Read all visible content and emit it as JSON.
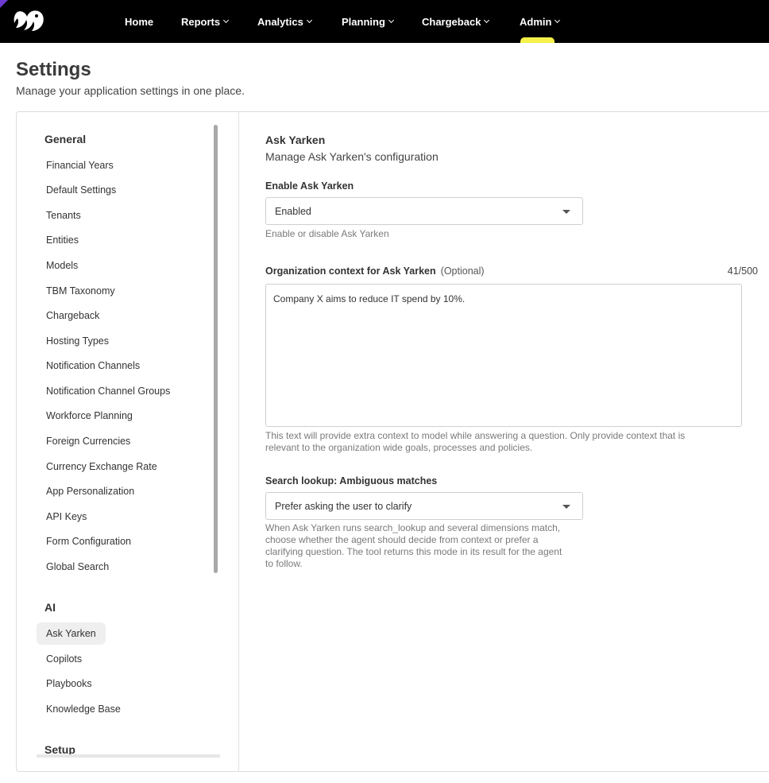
{
  "nav": {
    "items": [
      {
        "label": "Home",
        "has_dropdown": false
      },
      {
        "label": "Reports",
        "has_dropdown": true
      },
      {
        "label": "Analytics",
        "has_dropdown": true
      },
      {
        "label": "Planning",
        "has_dropdown": true
      },
      {
        "label": "Chargeback",
        "has_dropdown": true
      },
      {
        "label": "Admin",
        "has_dropdown": true,
        "active": true
      }
    ],
    "active_indicator_color": "#f6f14a",
    "background": "#000000"
  },
  "page": {
    "title": "Settings",
    "subtitle": "Manage your application settings in one place."
  },
  "sidebar": {
    "groups": [
      {
        "title": "General",
        "items": [
          "Financial Years",
          "Default Settings",
          "Tenants",
          "Entities",
          "Models",
          "TBM Taxonomy",
          "Chargeback",
          "Hosting Types",
          "Notification Channels",
          "Notification Channel Groups",
          "Workforce Planning",
          "Foreign Currencies",
          "Currency Exchange Rate",
          "App Personalization",
          "API Keys",
          "Form Configuration",
          "Global Search"
        ]
      },
      {
        "title": "AI",
        "items": [
          "Ask Yarken",
          "Copilots",
          "Playbooks",
          "Knowledge Base"
        ],
        "active_item": "Ask Yarken"
      },
      {
        "title": "Setup",
        "items": []
      }
    ]
  },
  "content": {
    "title": "Ask Yarken",
    "description": "Manage Ask Yarken's configuration",
    "enable": {
      "label": "Enable Ask Yarken",
      "value": "Enabled",
      "help": "Enable or disable Ask Yarken"
    },
    "context": {
      "label": "Organization context for Ask Yarken",
      "optional": "(Optional)",
      "counter": "41/500",
      "value": "Company X aims to reduce IT spend by 10%.",
      "help_line1": "This text will provide extra context to model while answering a question. Only provide context that is",
      "help_line2": "relevant to the organization wide goals, processes and policies."
    },
    "lookup": {
      "label": "Search lookup: Ambiguous matches",
      "value": "Prefer asking the user to clarify",
      "help_line1": "When Ask Yarken runs search_lookup and several dimensions match,",
      "help_line2": "choose whether the agent should decide from context or prefer a",
      "help_line3": "clarifying question. The tool returns this mode in its result for the agent",
      "help_line4": "to follow."
    }
  }
}
